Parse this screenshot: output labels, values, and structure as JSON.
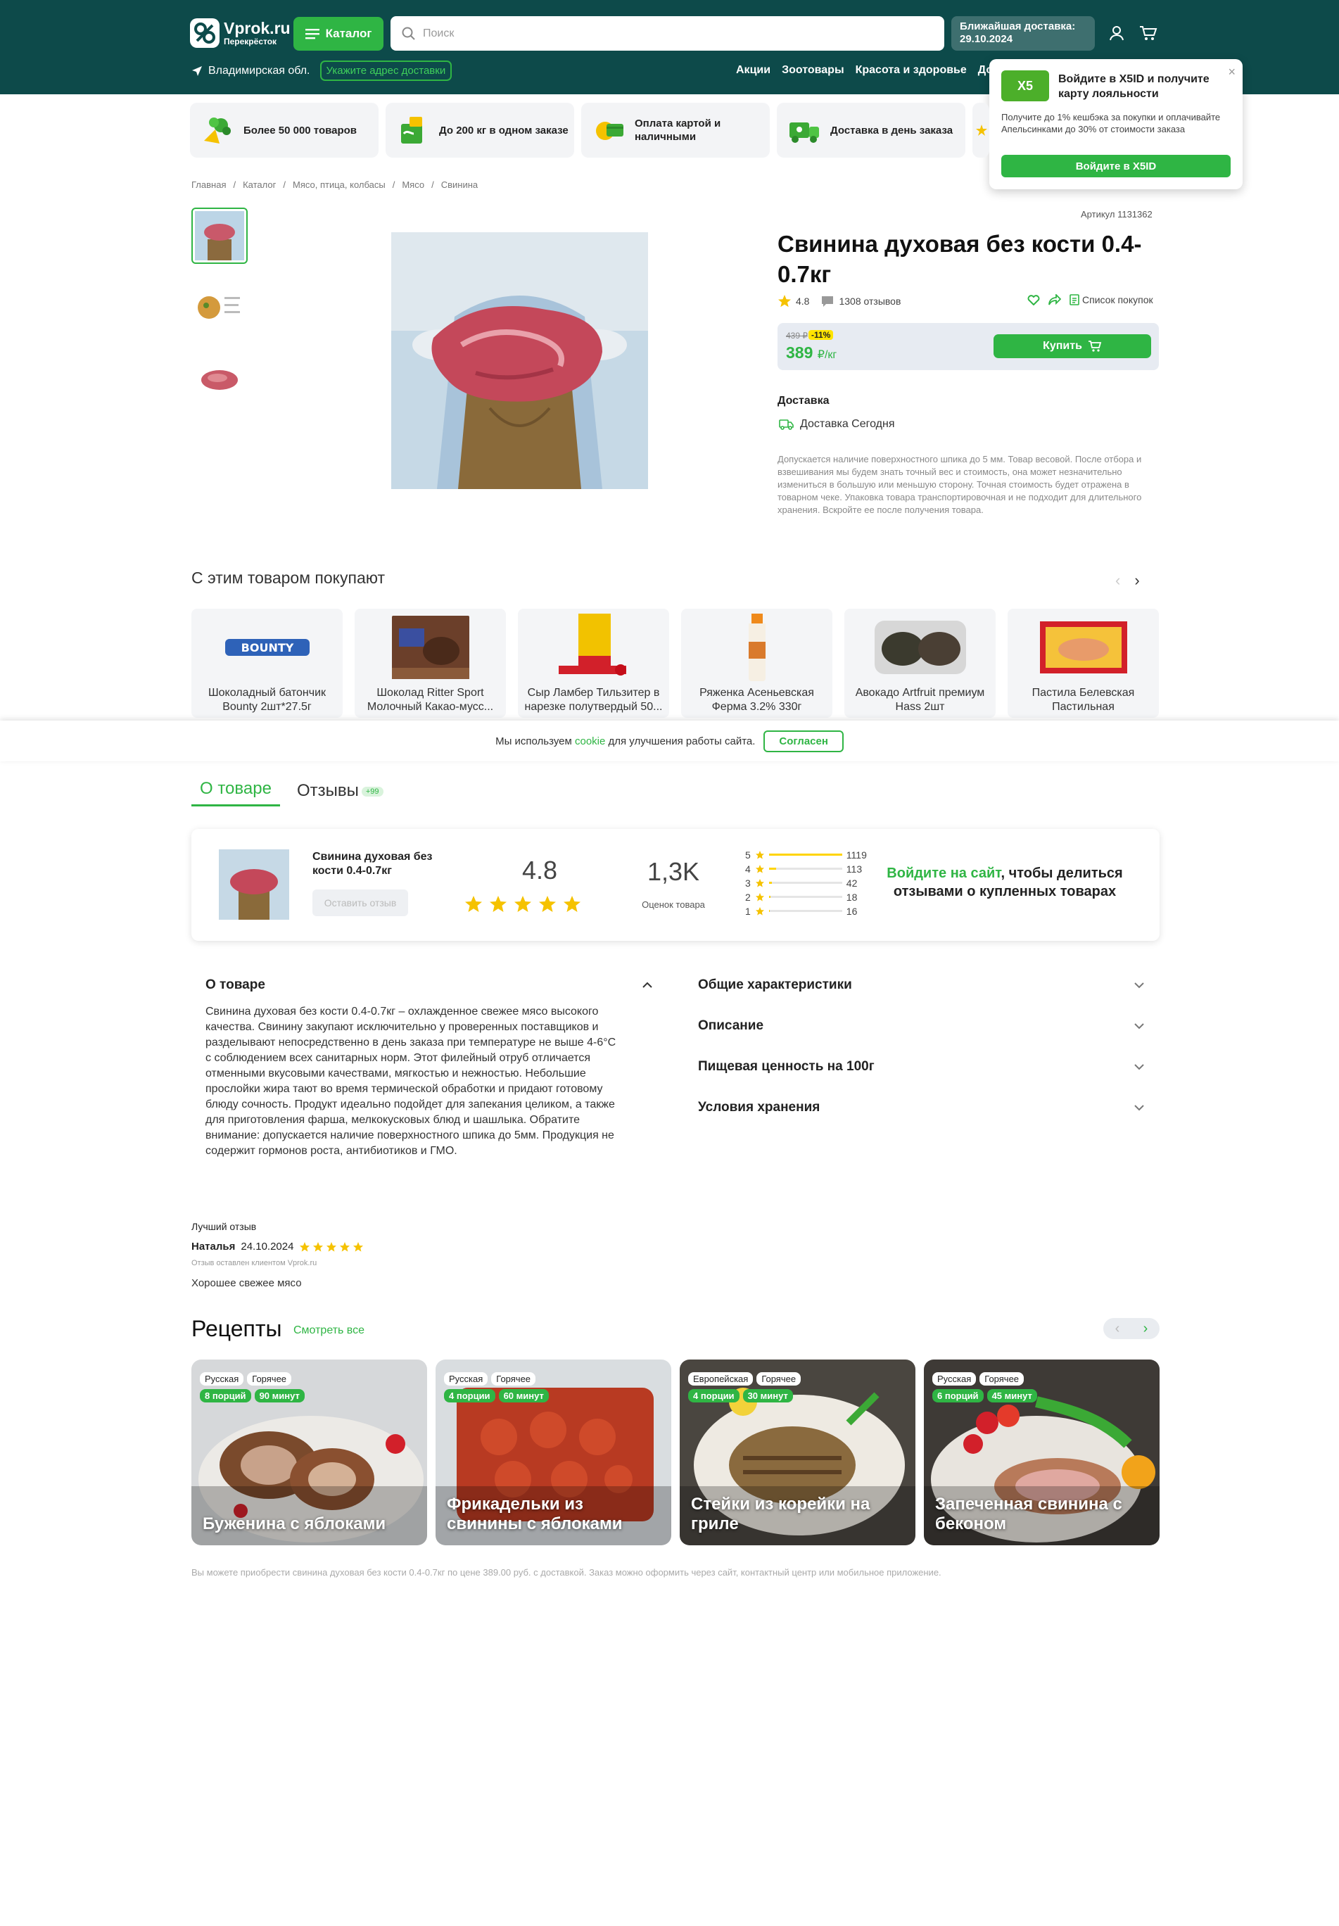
{
  "header": {
    "logo_title": "Vprok.ru",
    "logo_subtitle": "Перекрёсток",
    "catalog_label": "Каталог",
    "search_placeholder": "Поиск",
    "delivery_label": "Ближайшая доставка:",
    "delivery_date": "29.10.2024",
    "region": "Владимирская обл.",
    "address_button": "Укажите адрес доставки",
    "nav": [
      "Акции",
      "Зоотовары",
      "Красота и здоровье",
      "До"
    ]
  },
  "promo": {
    "logo_text": "X5",
    "title": "Войдите в X5ID и получите карту лояльности",
    "text": "Получите до 1% кешбэка за покупки и оплачивайте Апельсинками до 30% от стоимости заказа",
    "button": "Войдите в X5ID"
  },
  "features": [
    {
      "label": "Более 50 000 товаров",
      "icon": "vegetables-icon"
    },
    {
      "label": "До 200 кг в одном заказе",
      "icon": "package-icon"
    },
    {
      "label": "Оплата картой и наличными",
      "icon": "payment-icon"
    },
    {
      "label": "Доставка в день заказа",
      "icon": "delivery-truck-icon"
    }
  ],
  "breadcrumb": [
    "Главная",
    "/",
    "Каталог",
    "/",
    "Мясо, птица, колбасы",
    "/",
    "Мясо",
    "/",
    "Свинина"
  ],
  "product": {
    "article": "Артикул 1131362",
    "title": "Свинина духовая без кости 0.4-0.7кг",
    "rating": "4.8",
    "reviews_count": "1308 отзывов",
    "shopping_list": "Список покупок",
    "old_price": "439 ₽",
    "discount": "-11%",
    "price": "389",
    "price_unit": "₽/кг",
    "buy_label": "Купить",
    "delivery_title": "Доставка",
    "delivery_line": "Доставка Сегодня",
    "disclaimer": "Допускается наличие поверхностного шпика до 5 мм. Товар весовой. После отбора и взвешивания мы будем знать точный вес и стоимость, она может незначительно измениться в большую или меньшую сторону. Точная стоимость будет отражена в товарном чеке. Упаковка товара транспортировочная и не подходит для длительного хранения. Вскройте ее после получения товара."
  },
  "related": {
    "title": "С этим товаром покупают",
    "items": [
      {
        "name": "Шоколадный батончик Bounty 2шт*27.5г",
        "color": "#2e62b8"
      },
      {
        "name": "Шоколад Ritter Sport Молочный Какао-мусс...",
        "color": "#6b3f2a"
      },
      {
        "name": "Сыр Ламбер Тильзитер в нарезке полутвердый 50...",
        "color": "#f2c200"
      },
      {
        "name": "Ряженка Асеньевская Ферма 3.2% 330г",
        "color": "#ef8a1c"
      },
      {
        "name": "Авокадо Artfruit премиум Hass 2шт",
        "color": "#3b3a2e"
      },
      {
        "name": "Пастила Белевская Пастильная Мануфактур...",
        "color": "#d2202a"
      }
    ]
  },
  "cookie": {
    "text_before": "Мы используем",
    "link": "cookie",
    "text_after": "для улучшения работы сайта.",
    "button": "Согласен"
  },
  "tabs": {
    "about": "О товаре",
    "reviews": "Отзывы",
    "reviews_badge": "+99"
  },
  "review_summary": {
    "product_name": "Свинина духовая без кости 0.4-0.7кг",
    "leave_review": "Оставить отзыв",
    "score": "4.8",
    "count": "1,3K",
    "count_label": "Оценок товара",
    "bars": [
      {
        "star": "5",
        "count": "1119",
        "fraction": 1.0
      },
      {
        "star": "4",
        "count": "113",
        "fraction": 0.1
      },
      {
        "star": "3",
        "count": "42",
        "fraction": 0.04
      },
      {
        "star": "2",
        "count": "18",
        "fraction": 0.02
      },
      {
        "star": "1",
        "count": "16",
        "fraction": 0.015
      }
    ],
    "login_link": "Войдите на сайт",
    "login_text": ", чтобы делиться отзывами о купленных товарах"
  },
  "about": {
    "title": "О товаре",
    "text": "Свинина духовая без кости 0.4-0.7кг – охлажденное свежее мясо высокого качества. Свинину закупают исключительно у проверенных поставщиков и разделывают непосредственно в день заказа при температуре не выше 4-6°C с соблюдением всех санитарных норм. Этот филейный отруб отличается отменными вкусовыми качествами, мягкостью и нежностью. Небольшие прослойки жира тают во время термической обработки и придают готовому блюду сочность. Продукт идеально подойдет для запекания целиком, а также для приготовления фарша, мелкокусковых блюд и шашлыка. Обратите внимание: допускается наличие поверхностного шпика до 5мм. Продукция не содержит гормонов роста, антибиотиков и ГМО."
  },
  "characteristics": [
    "Общие характеристики",
    "Описание",
    "Пищевая ценность на 100г",
    "Условия хранения"
  ],
  "best_review": {
    "label": "Лучший отзыв",
    "author": "Наталья",
    "date": "24.10.2024",
    "note": "Отзыв оставлен клиентом Vprok.ru",
    "text": "Хорошее свежее мясо"
  },
  "recipes": {
    "title": "Рецепты",
    "see_all": "Смотреть все",
    "items": [
      {
        "tags": [
          "Русская",
          "Горячее"
        ],
        "portions": "8 порций",
        "time": "90 минут",
        "title": "Буженина с яблоками",
        "color": "#7a4a2c"
      },
      {
        "tags": [
          "Русская",
          "Горячее"
        ],
        "portions": "4 порции",
        "time": "60 минут",
        "title": "Фрикадельки из свинины с яблоками",
        "color": "#b8321c"
      },
      {
        "tags": [
          "Европейская",
          "Горячее"
        ],
        "portions": "4 порции",
        "time": "30 минут",
        "title": "Стейки из корейки на гриле",
        "color": "#8a6a3e"
      },
      {
        "tags": [
          "Русская",
          "Горячее"
        ],
        "portions": "6 порций",
        "time": "45 минут",
        "title": "Запеченная свинина с беконом",
        "color": "#6e3a2a"
      }
    ]
  },
  "footnote": "Вы можете приобрести свинина духовая без кости 0.4-0.7кг по цене 389.00 руб. с доставкой. Заказ можно оформить через сайт, контактный центр или мобильное приложение."
}
